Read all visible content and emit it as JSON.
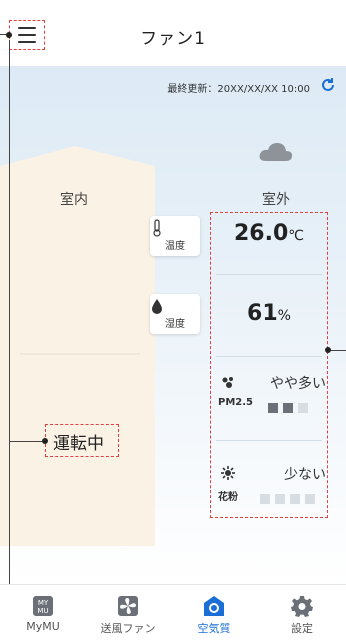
{
  "header": {
    "title": "ファン1"
  },
  "status": {
    "updated": "最終更新：20XX/XX/XX 10:00"
  },
  "labels": {
    "inside": "室内",
    "outside": "室外"
  },
  "chips": {
    "temperature": "温度",
    "humidity": "湿度"
  },
  "outside": {
    "weather_icon": "cloud-icon",
    "temperature_value": "26.0",
    "temperature_unit": "℃",
    "humidity_value": "61",
    "humidity_unit": "%",
    "pm25": {
      "level": "やや多い",
      "name": "PM2.5",
      "filled": 2,
      "total": 3
    },
    "pollen": {
      "level": "少ない",
      "name": "花粉",
      "filled": 0,
      "total": 4
    }
  },
  "running": {
    "text": "運転中"
  },
  "nav": {
    "items": [
      {
        "label": "MyMU",
        "icon": "mymu-icon",
        "badge": "MY\nMU"
      },
      {
        "label": "送風ファン",
        "icon": "fan-icon"
      },
      {
        "label": "空気質",
        "icon": "air-quality-icon",
        "active": true
      },
      {
        "label": "設定",
        "icon": "gear-icon"
      }
    ]
  },
  "colors": {
    "accent": "#1a6fd6",
    "highlight": "#e04040",
    "bar_on": "#6b7078",
    "bar_off": "#d8dde2"
  }
}
